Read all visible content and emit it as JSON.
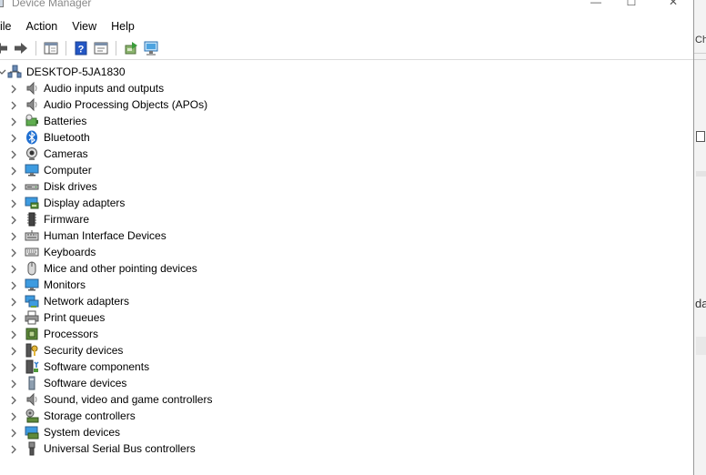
{
  "window": {
    "title": "Device Manager",
    "controls": {
      "minimize": "—",
      "maximize": "☐",
      "close": "✕"
    }
  },
  "menu": [
    "ile",
    "Action",
    "View",
    "Help"
  ],
  "toolbar": {
    "buttons": [
      "back",
      "forward",
      "show-hide-console-tree",
      "help",
      "properties",
      "update-driver",
      "scan-hardware"
    ]
  },
  "right_fragment": {
    "text1": "Cha",
    "text2": "da"
  },
  "tree": {
    "root": "DESKTOP-5JA1830",
    "categories": [
      {
        "label": "Audio inputs and outputs",
        "icon": "speaker-icon"
      },
      {
        "label": "Audio Processing Objects (APOs)",
        "icon": "speaker-icon"
      },
      {
        "label": "Batteries",
        "icon": "battery-icon"
      },
      {
        "label": "Bluetooth",
        "icon": "bluetooth-icon"
      },
      {
        "label": "Cameras",
        "icon": "camera-icon"
      },
      {
        "label": "Computer",
        "icon": "monitor-icon"
      },
      {
        "label": "Disk drives",
        "icon": "disk-drive-icon"
      },
      {
        "label": "Display adapters",
        "icon": "display-adapter-icon"
      },
      {
        "label": "Firmware",
        "icon": "firmware-icon"
      },
      {
        "label": "Human Interface Devices",
        "icon": "hid-icon"
      },
      {
        "label": "Keyboards",
        "icon": "keyboard-icon"
      },
      {
        "label": "Mice and other pointing devices",
        "icon": "mouse-icon"
      },
      {
        "label": "Monitors",
        "icon": "monitor-icon"
      },
      {
        "label": "Network adapters",
        "icon": "network-adapter-icon"
      },
      {
        "label": "Print queues",
        "icon": "printer-icon"
      },
      {
        "label": "Processors",
        "icon": "processor-icon"
      },
      {
        "label": "Security devices",
        "icon": "security-device-icon"
      },
      {
        "label": "Software components",
        "icon": "software-component-icon"
      },
      {
        "label": "Software devices",
        "icon": "software-device-icon"
      },
      {
        "label": "Sound, video and game controllers",
        "icon": "speaker-icon"
      },
      {
        "label": "Storage controllers",
        "icon": "storage-controller-icon"
      },
      {
        "label": "System devices",
        "icon": "system-device-icon"
      },
      {
        "label": "Universal Serial Bus controllers",
        "icon": "usb-icon"
      }
    ]
  },
  "colors": {
    "accent": "#1a73c9",
    "chevron": "#606060"
  }
}
